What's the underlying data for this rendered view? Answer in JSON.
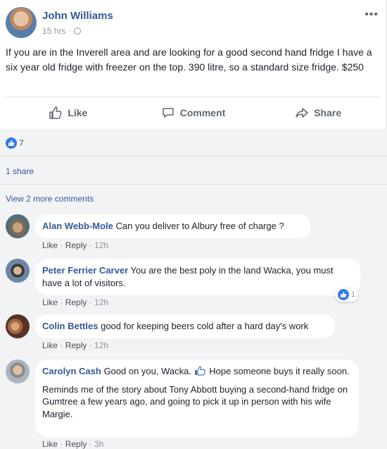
{
  "post": {
    "author": "John Williams",
    "time": "15 hrs",
    "dot": "·",
    "more": "•••",
    "text": "If you are in the Inverell area and are looking for a good second hand fridge I have a six year old fridge with freezer on the top. 390 litre, so a standard size fridge. $250"
  },
  "actions": {
    "like": "Like",
    "comment": "Comment",
    "share": "Share"
  },
  "stats": {
    "reaction_count": "7",
    "shares": "1 share",
    "view_more": "View 2 more comments"
  },
  "comments": [
    {
      "name": "Alan Webb-Mole",
      "text": "Can you deliver to Albury free of charge ?",
      "like": "Like",
      "reply": "Reply",
      "time": "12h"
    },
    {
      "name": "Peter Ferrier Carver",
      "text": "You are the best poly in the land Wacka, you must have a lot of visitors.",
      "like": "Like",
      "reply": "Reply",
      "time": "12h",
      "reaction_count": "1"
    },
    {
      "name": "Colin Bettles",
      "text": "good for keeping beers cold after a hard day's work",
      "like": "Like",
      "reply": "Reply",
      "time": "12h"
    },
    {
      "name": "Carolyn Cash",
      "text_before": "Good on you, Wacka.",
      "text_after": "Hope someone buys it really soon.",
      "text2": "Reminds me of the story about Tony Abbott buying a second-hand fridge on Gumtree a few years ago, and going to pick it up in person with his wife Margie.",
      "like": "Like",
      "reply": "Reply",
      "time": "3h"
    }
  ],
  "colors": {
    "link": "#365899",
    "like_blue": "#3578e5",
    "muted": "#90949c"
  }
}
